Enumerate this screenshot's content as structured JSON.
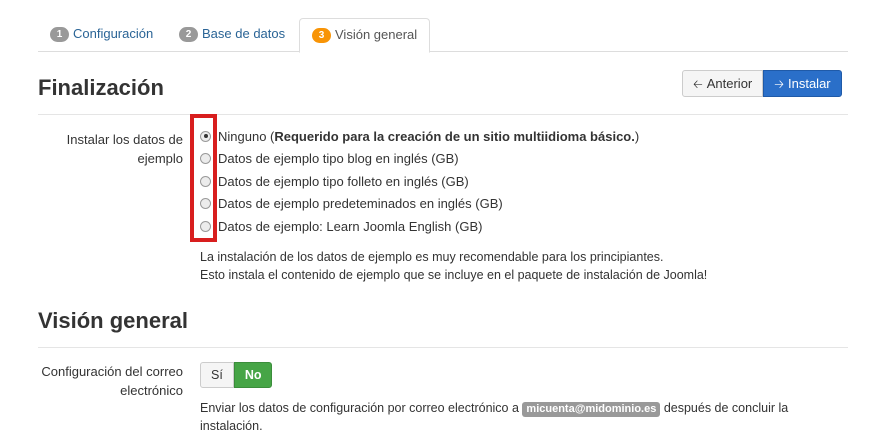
{
  "tabs": [
    {
      "num": "1",
      "label": "Configuración",
      "active": false
    },
    {
      "num": "2",
      "label": "Base de datos",
      "active": false
    },
    {
      "num": "3",
      "label": "Visión general",
      "active": true
    }
  ],
  "finalization": {
    "title": "Finalización",
    "buttons": {
      "previous": "Anterior",
      "install": "Instalar"
    },
    "sample_data_label": "Instalar los datos de ejemplo",
    "options": [
      {
        "prefix": "Ninguno (",
        "bold": "Requerido para la creación de un sitio multiidioma básico.",
        "suffix": ")",
        "checked": true
      },
      {
        "label": "Datos de ejemplo tipo blog en inglés (GB)",
        "checked": false
      },
      {
        "label": "Datos de ejemplo tipo folleto en inglés (GB)",
        "checked": false
      },
      {
        "label": "Datos de ejemplo predeteminados en inglés (GB)",
        "checked": false
      },
      {
        "label": "Datos de ejemplo: Learn Joomla English (GB)",
        "checked": false
      }
    ],
    "help_line1": "La instalación de los datos de ejemplo es muy recomendable para los principiantes.",
    "help_line2": "Esto instala el contenido de ejemplo que se incluye en el paquete de instalación de Joomla!"
  },
  "overview": {
    "title": "Visión general",
    "email_label": "Configuración del correo electrónico",
    "toggle": {
      "yes": "Sí",
      "no": "No",
      "selected": "No"
    },
    "email_help_before": "Enviar los datos de configuración por correo electrónico a",
    "email_address": "micuenta@midominio.es",
    "email_help_after": "después de concluir la",
    "email_help_line2": "instalación."
  },
  "colors": {
    "accent": "#2a6fc9",
    "success": "#46a546",
    "active_badge": "#f89406",
    "highlight": "#d81e1e"
  },
  "icons": {
    "previous": "arrow-left-icon",
    "install": "arrow-right-icon"
  }
}
